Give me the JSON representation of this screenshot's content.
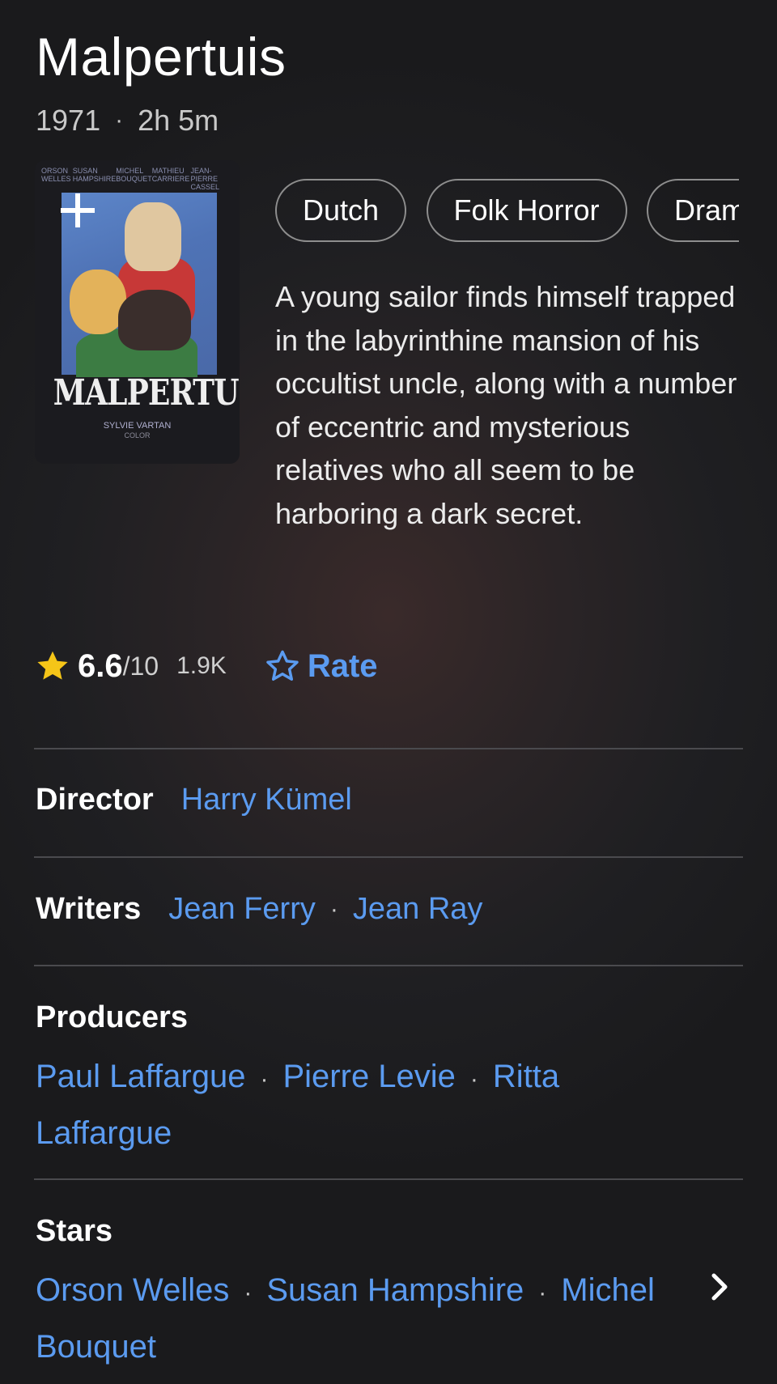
{
  "movie": {
    "title": "Malpertuis",
    "year": "1971",
    "meta_separator": "·",
    "runtime": "2h 5m",
    "poster": {
      "credits": [
        "ORSON WELLES",
        "SUSAN HAMPSHIRE",
        "MICHEL BOUQUET",
        "MATHIEU CARRIERE",
        "JEAN-PIERRE CASSEL"
      ],
      "logo": "MALPERTUIS",
      "footer_name": "SYLVIE VARTAN",
      "footer_color": "COLOR"
    },
    "genres": [
      "Dutch",
      "Folk Horror",
      "Drama"
    ],
    "plot": "A young sailor finds himself trapped in the labyrinthine mansion of his occultist uncle, along with a number of eccentric and mysterious relatives who all seem to be harboring a dark secret."
  },
  "rating": {
    "value": "6.6",
    "max": "/10",
    "count": "1.9K",
    "rate_label": "Rate",
    "star_color": "#f5c518"
  },
  "credits": {
    "director": {
      "label": "Director",
      "names": [
        "Harry Kümel"
      ]
    },
    "writers": {
      "label": "Writers",
      "names": [
        "Jean Ferry",
        "Jean Ray"
      ]
    },
    "producers": {
      "label": "Producers",
      "names": [
        "Paul Laffargue",
        "Pierre Levie",
        "Ritta Laffargue"
      ]
    },
    "stars": {
      "label": "Stars",
      "names": [
        "Orson Welles",
        "Susan Hampshire",
        "Michel Bouquet"
      ]
    },
    "separator": "·"
  },
  "icons": {
    "add": "plus-icon",
    "star_filled": "star-filled-icon",
    "star_outline": "star-outline-icon",
    "more": "chevron-right-icon"
  },
  "colors": {
    "link": "#5b9bf0",
    "background": "#1f1f22",
    "divider": "#4a4a4e"
  }
}
